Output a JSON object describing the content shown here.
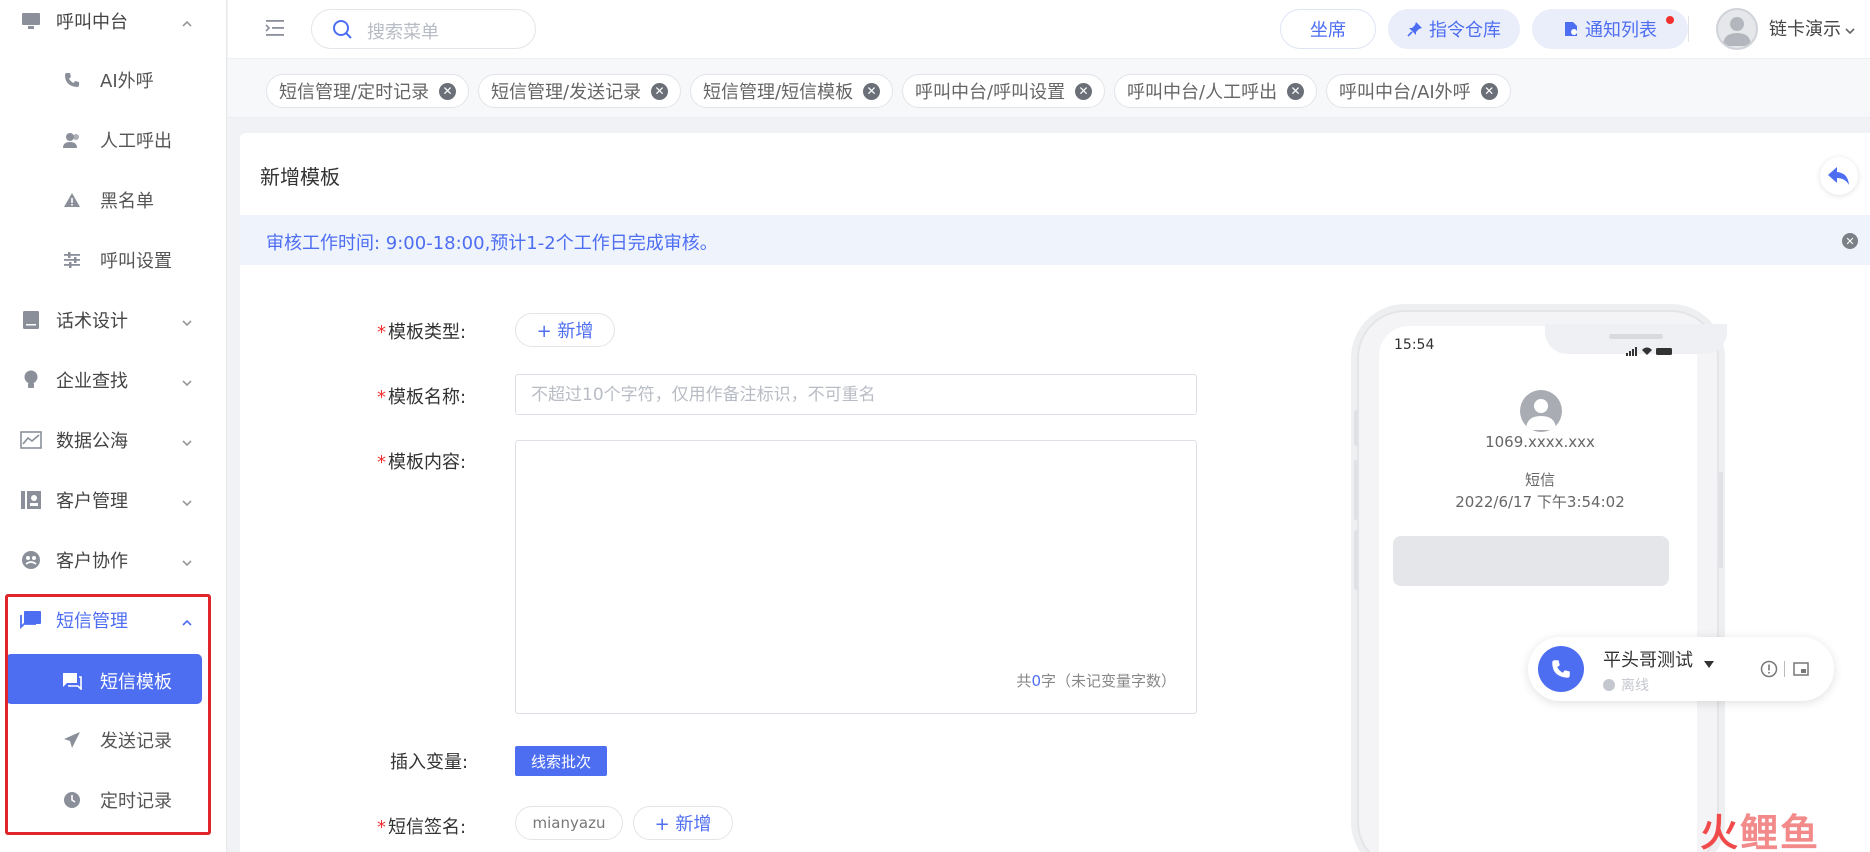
{
  "sidebar": {
    "groups": [
      {
        "label": "呼叫中台",
        "icon": "monitor-icon",
        "expanded": true
      },
      {
        "label": "话术设计",
        "icon": "book-icon",
        "expanded": false
      },
      {
        "label": "企业查找",
        "icon": "bulb-icon",
        "expanded": false
      },
      {
        "label": "数据公海",
        "icon": "chart-icon",
        "expanded": false
      },
      {
        "label": "客户管理",
        "icon": "contacts-icon",
        "expanded": false
      },
      {
        "label": "客户协作",
        "icon": "team-icon",
        "expanded": false
      },
      {
        "label": "短信管理",
        "icon": "message-icon",
        "expanded": true,
        "active": true
      }
    ],
    "call_items": [
      {
        "label": "AI外呼",
        "icon": "phone-icon"
      },
      {
        "label": "人工呼出",
        "icon": "users-icon"
      },
      {
        "label": "黑名单",
        "icon": "warning-icon"
      },
      {
        "label": "呼叫设置",
        "icon": "sliders-icon"
      }
    ],
    "sms_items": [
      {
        "label": "短信模板",
        "icon": "chat-icon",
        "selected": true
      },
      {
        "label": "发送记录",
        "icon": "send-icon"
      },
      {
        "label": "定时记录",
        "icon": "clock-icon"
      }
    ]
  },
  "header": {
    "search_placeholder": "搜索菜单",
    "seat_label": "坐席",
    "command_label": "指令仓库",
    "notify_label": "通知列表",
    "username": "链卡演示"
  },
  "tabs": [
    {
      "label": "短信管理/定时记录"
    },
    {
      "label": "短信管理/发送记录"
    },
    {
      "label": "短信管理/短信模板"
    },
    {
      "label": "呼叫中台/呼叫设置"
    },
    {
      "label": "呼叫中台/人工呼出"
    },
    {
      "label": "呼叫中台/AI外呼"
    }
  ],
  "page": {
    "title": "新增模板",
    "notice": "审核工作时间: 9:00-18:00,预计1-2个工作日完成审核。",
    "form": {
      "template_type_label": "模板类型:",
      "add_label": "+ 新增",
      "template_name_label": "模板名称:",
      "template_name_placeholder": "不超过10个字符，仅用作备注标识，不可重名",
      "template_content_label": "模板内容:",
      "counter_prefix": "共",
      "counter_count": "0",
      "counter_suffix": "字（未记变量字数）",
      "insert_var_label": "插入变量:",
      "var_button": "线索批次",
      "signature_label": "短信签名:",
      "signature_value": "mianyazu"
    }
  },
  "phone": {
    "time": "15:54",
    "sender": "1069.xxxx.xxx",
    "type": "短信",
    "datetime": "2022/6/17 下午3:54:02"
  },
  "call_widget": {
    "name": "平头哥测试",
    "status": "离线"
  },
  "watermark": {
    "part1": "火",
    "part2": "鲤鱼"
  },
  "colors": {
    "accent": "#4e6ef2",
    "highlight": "#e0262a",
    "required": "#f23030"
  }
}
